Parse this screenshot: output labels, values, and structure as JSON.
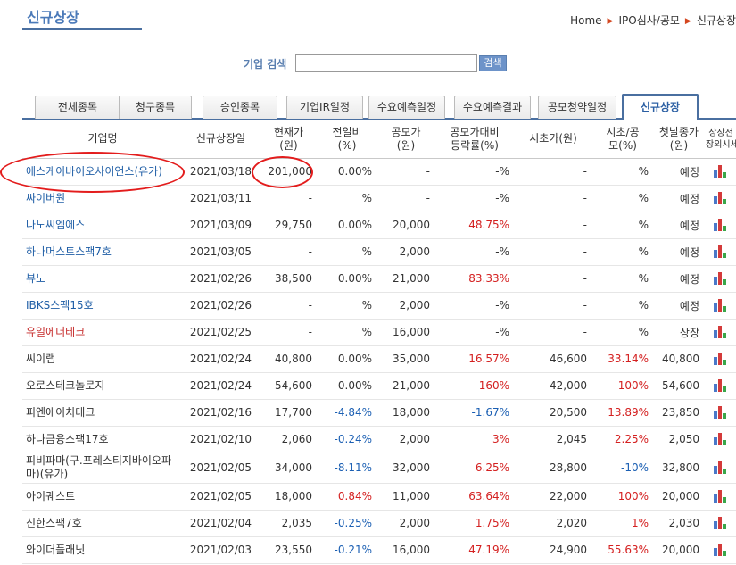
{
  "page": {
    "title": "신규상장"
  },
  "breadcrumb": [
    "Home",
    "IPO심사/공모",
    "신규상장"
  ],
  "search": {
    "label": "기업 검색",
    "value": "",
    "button": "검색"
  },
  "tabs": [
    {
      "label": "전체종목",
      "active": false
    },
    {
      "label": "청구종목",
      "active": false
    },
    {
      "label": "승인종목",
      "active": false
    },
    {
      "label": "기업IR일정",
      "active": false
    },
    {
      "label": "수요예측일정",
      "active": false
    },
    {
      "label": "수요예측결과",
      "active": false
    },
    {
      "label": "공모청약일정",
      "active": false
    },
    {
      "label": "신규상장",
      "active": true
    }
  ],
  "table": {
    "headers": [
      [
        "기업명"
      ],
      [
        "신규상장일"
      ],
      [
        "현재가",
        "(원)"
      ],
      [
        "전일비",
        "(%)"
      ],
      [
        "공모가",
        "(원)"
      ],
      [
        "공모가대비",
        "등락률(%)"
      ],
      [
        "시초가(원)"
      ],
      [
        "시초/공",
        "모(%)"
      ],
      [
        "첫날종가",
        "(원)"
      ],
      [
        "상장전",
        "장외시세"
      ]
    ],
    "rows": [
      {
        "name": "에스케이바이오사이언스(유가)",
        "name_color": "blue",
        "date": "2021/03/18",
        "price": "201,000",
        "change": "0.00%",
        "change_dir": "none",
        "ipo_price": "-",
        "ipo_return": "-%",
        "ipo_return_dir": "none",
        "open": "-",
        "open_ratio": "%",
        "open_ratio_dir": "none",
        "first_close": "예정"
      },
      {
        "name": "싸이버원",
        "name_color": "blue",
        "date": "2021/03/11",
        "price": "-",
        "change": "%",
        "change_dir": "none",
        "ipo_price": "-",
        "ipo_return": "-%",
        "ipo_return_dir": "none",
        "open": "-",
        "open_ratio": "%",
        "open_ratio_dir": "none",
        "first_close": "예정"
      },
      {
        "name": "나노씨엠에스",
        "name_color": "blue",
        "date": "2021/03/09",
        "price": "29,750",
        "change": "0.00%",
        "change_dir": "none",
        "ipo_price": "20,000",
        "ipo_return": "48.75%",
        "ipo_return_dir": "up",
        "open": "-",
        "open_ratio": "%",
        "open_ratio_dir": "none",
        "first_close": "예정"
      },
      {
        "name": "하나머스트스팩7호",
        "name_color": "blue",
        "date": "2021/03/05",
        "price": "-",
        "change": "%",
        "change_dir": "none",
        "ipo_price": "2,000",
        "ipo_return": "-%",
        "ipo_return_dir": "none",
        "open": "-",
        "open_ratio": "%",
        "open_ratio_dir": "none",
        "first_close": "예정"
      },
      {
        "name": "뷰노",
        "name_color": "blue",
        "date": "2021/02/26",
        "price": "38,500",
        "change": "0.00%",
        "change_dir": "none",
        "ipo_price": "21,000",
        "ipo_return": "83.33%",
        "ipo_return_dir": "up",
        "open": "-",
        "open_ratio": "%",
        "open_ratio_dir": "none",
        "first_close": "예정"
      },
      {
        "name": "IBKS스팩15호",
        "name_color": "blue",
        "date": "2021/02/26",
        "price": "-",
        "change": "%",
        "change_dir": "none",
        "ipo_price": "2,000",
        "ipo_return": "-%",
        "ipo_return_dir": "none",
        "open": "-",
        "open_ratio": "%",
        "open_ratio_dir": "none",
        "first_close": "예정"
      },
      {
        "name": "유일에너테크",
        "name_color": "red",
        "date": "2021/02/25",
        "price": "-",
        "change": "%",
        "change_dir": "none",
        "ipo_price": "16,000",
        "ipo_return": "-%",
        "ipo_return_dir": "none",
        "open": "-",
        "open_ratio": "%",
        "open_ratio_dir": "none",
        "first_close": "상장"
      },
      {
        "name": "씨이랩",
        "name_color": "dark",
        "date": "2021/02/24",
        "price": "40,800",
        "change": "0.00%",
        "change_dir": "none",
        "ipo_price": "35,000",
        "ipo_return": "16.57%",
        "ipo_return_dir": "up",
        "open": "46,600",
        "open_ratio": "33.14%",
        "open_ratio_dir": "up",
        "first_close": "40,800"
      },
      {
        "name": "오로스테크놀로지",
        "name_color": "dark",
        "date": "2021/02/24",
        "price": "54,600",
        "change": "0.00%",
        "change_dir": "none",
        "ipo_price": "21,000",
        "ipo_return": "160%",
        "ipo_return_dir": "up",
        "open": "42,000",
        "open_ratio": "100%",
        "open_ratio_dir": "up",
        "first_close": "54,600"
      },
      {
        "name": "피엔에이치테크",
        "name_color": "dark",
        "date": "2021/02/16",
        "price": "17,700",
        "change": "-4.84%",
        "change_dir": "down",
        "ipo_price": "18,000",
        "ipo_return": "-1.67%",
        "ipo_return_dir": "down",
        "open": "20,500",
        "open_ratio": "13.89%",
        "open_ratio_dir": "up",
        "first_close": "23,850"
      },
      {
        "name": "하나금융스팩17호",
        "name_color": "dark",
        "date": "2021/02/10",
        "price": "2,060",
        "change": "-0.24%",
        "change_dir": "down",
        "ipo_price": "2,000",
        "ipo_return": "3%",
        "ipo_return_dir": "up",
        "open": "2,045",
        "open_ratio": "2.25%",
        "open_ratio_dir": "up",
        "first_close": "2,050"
      },
      {
        "name": "피비파마(구.프레스티지바이오파마)(유가)",
        "name_color": "dark",
        "date": "2021/02/05",
        "price": "34,000",
        "change": "-8.11%",
        "change_dir": "down",
        "ipo_price": "32,000",
        "ipo_return": "6.25%",
        "ipo_return_dir": "up",
        "open": "28,800",
        "open_ratio": "-10%",
        "open_ratio_dir": "down",
        "first_close": "32,800",
        "tall": true
      },
      {
        "name": "아이퀘스트",
        "name_color": "dark",
        "date": "2021/02/05",
        "price": "18,000",
        "change": "0.84%",
        "change_dir": "up",
        "ipo_price": "11,000",
        "ipo_return": "63.64%",
        "ipo_return_dir": "up",
        "open": "22,000",
        "open_ratio": "100%",
        "open_ratio_dir": "up",
        "first_close": "20,000"
      },
      {
        "name": "신한스팩7호",
        "name_color": "dark",
        "date": "2021/02/04",
        "price": "2,035",
        "change": "-0.25%",
        "change_dir": "down",
        "ipo_price": "2,000",
        "ipo_return": "1.75%",
        "ipo_return_dir": "up",
        "open": "2,020",
        "open_ratio": "1%",
        "open_ratio_dir": "up",
        "first_close": "2,030"
      },
      {
        "name": "와이더플래닛",
        "name_color": "dark",
        "date": "2021/02/03",
        "price": "23,550",
        "change": "-0.21%",
        "change_dir": "down",
        "ipo_price": "16,000",
        "ipo_return": "47.19%",
        "ipo_return_dir": "up",
        "open": "24,900",
        "open_ratio": "55.63%",
        "open_ratio_dir": "up",
        "first_close": "20,000"
      }
    ]
  },
  "icons": {
    "otc_chart": "bar-chart-icon"
  },
  "colors": {
    "accent": "#4a6fa0",
    "up": "#d42020",
    "down": "#1b5fb3",
    "annotation": "#e31c1c"
  }
}
